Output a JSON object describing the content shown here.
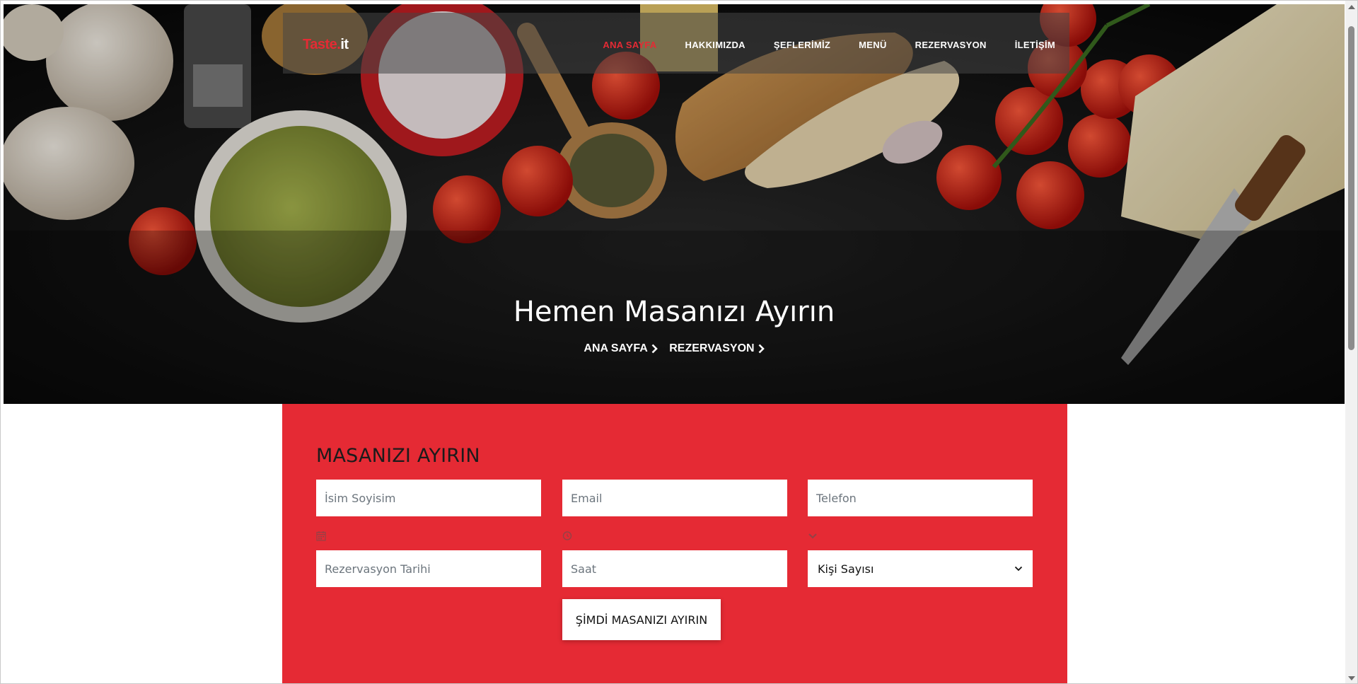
{
  "brand": {
    "part1": "Taste.",
    "part2": "it"
  },
  "nav": {
    "items": [
      {
        "label": "ANA SAYFA",
        "active": true
      },
      {
        "label": "HAKKIMIZDA",
        "active": false
      },
      {
        "label": "ŞEFLERİMİZ",
        "active": false
      },
      {
        "label": "MENÜ",
        "active": false
      },
      {
        "label": "REZERVASYON",
        "active": false
      },
      {
        "label": "İLETİŞİM",
        "active": false
      }
    ]
  },
  "hero": {
    "title": "Hemen Masanızı Ayırın",
    "breadcrumb": [
      "ANA SAYFA",
      "REZERVASYON"
    ]
  },
  "reservation": {
    "heading": "MASANIZI AYIRIN",
    "name_placeholder": "İsim Soyisim",
    "email_placeholder": "Email",
    "phone_placeholder": "Telefon",
    "date_placeholder": "Rezervasyon Tarihi",
    "time_placeholder": "Saat",
    "guests_selected": "Kişi Sayısı",
    "icons": [
      "calendar-icon",
      "clock-icon",
      "chevron-down-icon"
    ],
    "submit_label": "ŞİMDİ MASANIZI AYIRIN"
  },
  "colors": {
    "accent": "#e52a34",
    "panel": "#e52a34",
    "hero_bg": "#121212"
  }
}
